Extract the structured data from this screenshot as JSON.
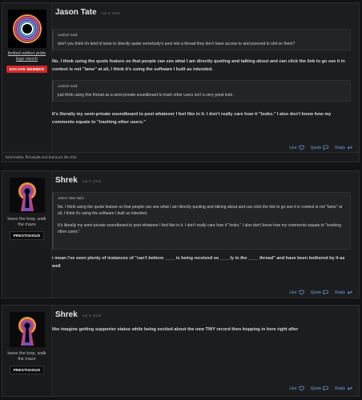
{
  "colors": {
    "accent": "#6fa0d8",
    "badge_red": "#d42a2a",
    "background": "#121314"
  },
  "posts": [
    {
      "author": "Jason Tate",
      "date": "Apr 9, 2018",
      "user_title": "limited edition pride logo merch",
      "badge": "ESCAPE MEMBER",
      "quotes": [
        {
          "author": "caobcit said:",
          "text": "don't you think it's kind of lame to directly quote somebody's post into a thread they don't have access to and proceed to shit on them?"
        },
        {
          "author": "caobcit said:",
          "text": "just think using this thread as a semi-private soundboard to trash other users isn't a very great look."
        }
      ],
      "replies": [
        "No. I think using the quote feature so that people can see what I am directly quoting and talking about and can click the link to go see it in context is not \"lame\" at all, I think it's using the software I built as intended.",
        "It's literally my semi-private soundboard to post whatever I feel like in it. I don't really care how it \"looks.\" I also don't know how my comments equate to \"trashing other users.\""
      ],
      "actions": {
        "like": "Like",
        "quote": "Quote",
        "reply": "Reply"
      },
      "likes_text": "bschmid84, ffrmsty89 and fearous1 like this."
    },
    {
      "author": "Shrek",
      "date": "Apr 9, 2018",
      "user_title": "leave the loop, walk the maze",
      "badge": "PRESTIGIOUS",
      "quote": {
        "author": "Jason Tate said:",
        "text1": "No. I think using the quote feature so that people can see what I am directly quoting and talking about and can click the link to go see it in context is not \"lame\" at all, I think it's using the software I built as intended.",
        "text2": "It's literally my semi-private soundboard to post whatever I feel like in it. I don't really care how it \"looks.\" I also don't know how my comments equate to \"trashing other users.\""
      },
      "reply": "i mean i've seen plenty of instances of \"can't believe ____ is being received so ____ly in the ____ thread\" and have been bothered by it as well",
      "actions": {
        "like": "Like",
        "quote": "Quote",
        "reply": "Reply"
      }
    },
    {
      "author": "Shrek",
      "date": "Apr 9, 2018",
      "user_title": "leave the loop, walk the maze",
      "badge": "PRESTIGIOUS",
      "reply": "like imagine getting supporter status while being excited about the new TWY record then hopping in here right after",
      "actions": {
        "like": "Like",
        "quote": "Quote",
        "reply": "Reply"
      }
    }
  ]
}
